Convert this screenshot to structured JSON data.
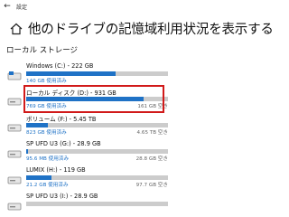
{
  "window": {
    "title": "設定",
    "back_icon": "back-arrow-icon"
  },
  "header": {
    "title": "他のドライブの記憶域利用状況を表示する",
    "icon": "home-icon"
  },
  "section": {
    "title": "ローカル ストレージ"
  },
  "colors": {
    "accent": "#1f72c6",
    "bar_track": "#cccccc",
    "highlight": "#d11a1a"
  },
  "drives": [
    {
      "name": "Windows (C:) - 222 GB",
      "used": "140 GB 使用済み",
      "free": "",
      "used_fraction": 0.63,
      "icon": "windows-drive-icon"
    },
    {
      "name": "ローカル ディスク (D:) - 931 GB",
      "used": "769 GB 使用済み",
      "free": "161 GB 空き",
      "used_fraction": 0.83,
      "icon": "hard-drive-icon"
    },
    {
      "name": "ボリューム (F:) - 5.45 TB",
      "used": "823 GB 使用済み",
      "free": "4.65 TB 空き",
      "used_fraction": 0.15,
      "icon": "hard-drive-icon"
    },
    {
      "name": "SP UFD U3 (G:) - 28.9 GB",
      "used": "95.6 MB 使用済み",
      "free": "28.8 GB 空き",
      "used_fraction": 0.01,
      "icon": "hard-drive-icon"
    },
    {
      "name": "LUMIX (H:) - 119 GB",
      "used": "21.2 GB 使用済み",
      "free": "97.7 GB 空き",
      "used_fraction": 0.18,
      "icon": "hard-drive-icon"
    },
    {
      "name": "SP UFD U3 (I:) - 28.9 GB",
      "used": "",
      "free": "",
      "used_fraction": null,
      "icon": "hard-drive-icon"
    }
  ]
}
